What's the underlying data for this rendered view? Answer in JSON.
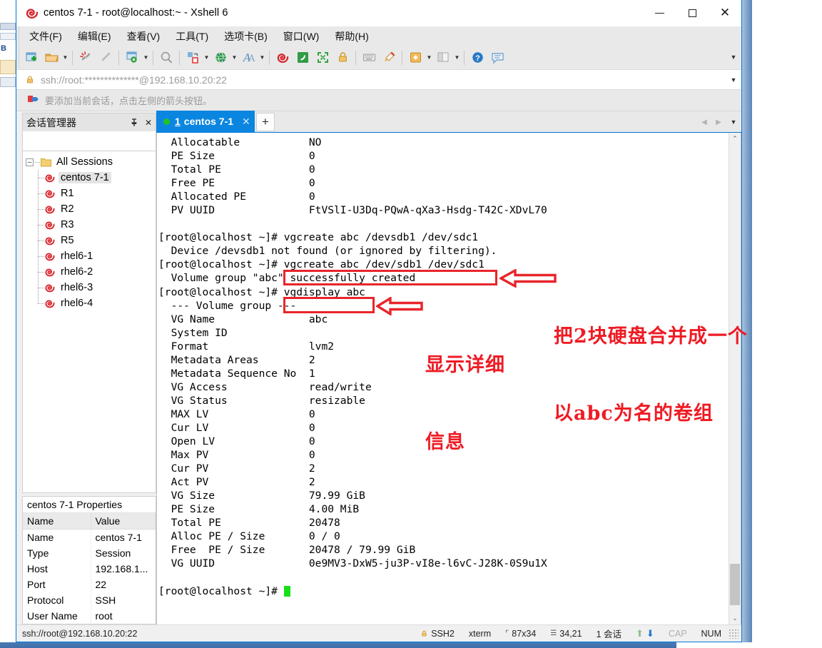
{
  "window": {
    "title": "centos 7-1 - root@localhost:~ - Xshell 6",
    "icon": "xshell-logo-icon",
    "minimize": "–",
    "maximize": "□",
    "close": "✕"
  },
  "menubar": {
    "items": [
      {
        "label": "文件(F)",
        "name": "menu-file"
      },
      {
        "label": "编辑(E)",
        "name": "menu-edit"
      },
      {
        "label": "查看(V)",
        "name": "menu-view"
      },
      {
        "label": "工具(T)",
        "name": "menu-tools"
      },
      {
        "label": "选项卡(B)",
        "name": "menu-tabs"
      },
      {
        "label": "窗口(W)",
        "name": "menu-window"
      },
      {
        "label": "帮助(H)",
        "name": "menu-help"
      }
    ]
  },
  "toolbar": {
    "overflow": "▼",
    "buttons": [
      {
        "name": "new-session-icon",
        "caret": false
      },
      {
        "name": "open-folder-icon",
        "caret": true
      },
      {
        "name": "disconnect-icon",
        "caret": false
      },
      {
        "name": "reconnect-icon",
        "caret": false
      },
      {
        "name": "session-properties-icon",
        "caret": true
      },
      {
        "name": "find-icon",
        "caret": false
      },
      {
        "name": "file-transfer-icon",
        "caret": true
      },
      {
        "name": "globe-icon",
        "caret": true
      },
      {
        "name": "font-icon",
        "caret": true
      },
      {
        "name": "xshell-icon",
        "caret": false
      },
      {
        "name": "xftp-icon",
        "caret": false
      },
      {
        "name": "fullscreen-icon",
        "caret": false
      },
      {
        "name": "lock-icon",
        "caret": false
      },
      {
        "name": "keyboard-icon",
        "caret": false
      },
      {
        "name": "highlight-icon",
        "caret": false
      },
      {
        "name": "add-tab-icon",
        "caret": true
      },
      {
        "name": "split-view-icon",
        "caret": true
      },
      {
        "name": "help-icon",
        "caret": false
      },
      {
        "name": "comment-icon",
        "caret": false
      }
    ]
  },
  "address_bar": {
    "icon": "lock-icon",
    "value": "ssh://root:**************@192.168.10.20:22",
    "caret": "▼"
  },
  "alert_bar": {
    "icon": "arrow-flag-icon",
    "text": "要添加当前会话，点击左侧的箭头按钮。"
  },
  "sidebar": {
    "title": "会话管理器",
    "pin": "➤",
    "close": "✕",
    "search_placeholder": "",
    "search_value": "",
    "search_icon": "search-icon",
    "root": {
      "label": "All Sessions",
      "expander": "–"
    },
    "sessions": [
      {
        "label": "centos 7-1",
        "selected": true
      },
      {
        "label": "R1",
        "selected": false
      },
      {
        "label": "R2",
        "selected": false
      },
      {
        "label": "R3",
        "selected": false
      },
      {
        "label": "R5",
        "selected": false
      },
      {
        "label": "rhel6-1",
        "selected": false
      },
      {
        "label": "rhel6-2",
        "selected": false
      },
      {
        "label": "rhel6-3",
        "selected": false
      },
      {
        "label": "rhel6-4",
        "selected": false
      }
    ]
  },
  "properties": {
    "title": "centos 7-1 Properties",
    "columns": [
      "Name",
      "Value"
    ],
    "rows": [
      [
        "Name",
        "centos 7-1"
      ],
      [
        "Type",
        "Session"
      ],
      [
        "Host",
        "192.168.1..."
      ],
      [
        "Port",
        "22"
      ],
      [
        "Protocol",
        "SSH"
      ],
      [
        "User Name",
        "root"
      ]
    ]
  },
  "tabs": {
    "items": [
      {
        "index": "1",
        "label": "centos 7-1",
        "active": true,
        "close": "✕",
        "status": "connected"
      }
    ],
    "new_tab": "+",
    "nav_prev": "◀",
    "nav_next": "▶",
    "menu": "▼"
  },
  "terminal": {
    "lines": [
      "  Allocatable           NO",
      "  PE Size               0",
      "  Total PE              0",
      "  Free PE               0",
      "  Allocated PE          0",
      "  PV UUID               FtVSlI-U3Dq-PQwA-qXa3-Hsdg-T42C-XDvL70",
      "",
      "[root@localhost ~]# vgcreate abc /devsdb1 /dev/sdc1",
      "  Device /devsdb1 not found (or ignored by filtering).",
      "[root@localhost ~]# vgcreate abc /dev/sdb1 /dev/sdc1",
      "  Volume group \"abc\" successfully created",
      "[root@localhost ~]# vgdisplay abc",
      "  --- Volume group ---",
      "  VG Name               abc",
      "  System ID",
      "  Format                lvm2",
      "  Metadata Areas        2",
      "  Metadata Sequence No  1",
      "  VG Access             read/write",
      "  VG Status             resizable",
      "  MAX LV                0",
      "  Cur LV                0",
      "  Open LV               0",
      "  Max PV                0",
      "  Cur PV                2",
      "  Act PV                2",
      "  VG Size               79.99 GiB",
      "  PE Size               4.00 MiB",
      "  Total PE              20478",
      "  Alloc PE / Size       0 / 0",
      "  Free  PE / Size       20478 / 79.99 GiB",
      "  VG UUID               0e9MV3-DxW5-ju3P-vI8e-l6vC-J28K-0S9u1X",
      "",
      "[root@localhost ~]# "
    ],
    "prompt_cursor": "block-cursor",
    "scroll_up": "⌃",
    "scroll_down": "⌄"
  },
  "annotations": {
    "color": "#ef1b24",
    "box_vgcreate": "vgcreate abc /dev/sdb1 /dev/sdc1",
    "box_vgdisplay": "vgdisplay abc",
    "note_right_line1": "把2块硬盘合并成一个",
    "note_right_line2": "以abc为名的卷组",
    "note_left_line1": "显示详细",
    "note_left_line2": "信息"
  },
  "statusbar": {
    "left": "ssh://root@192.168.10.20:22",
    "lock_icon": "lock-icon",
    "protocol": "SSH2",
    "term_type": "xterm",
    "size_icon": "screen-size-icon",
    "size": "87x34",
    "cursor_icon": "cursor-pos-icon",
    "cursor_pos": "34,21",
    "sessions": "1 会话",
    "up_icon": "⬆",
    "down_icon": "⬇",
    "cap": "CAP",
    "num": "NUM"
  }
}
